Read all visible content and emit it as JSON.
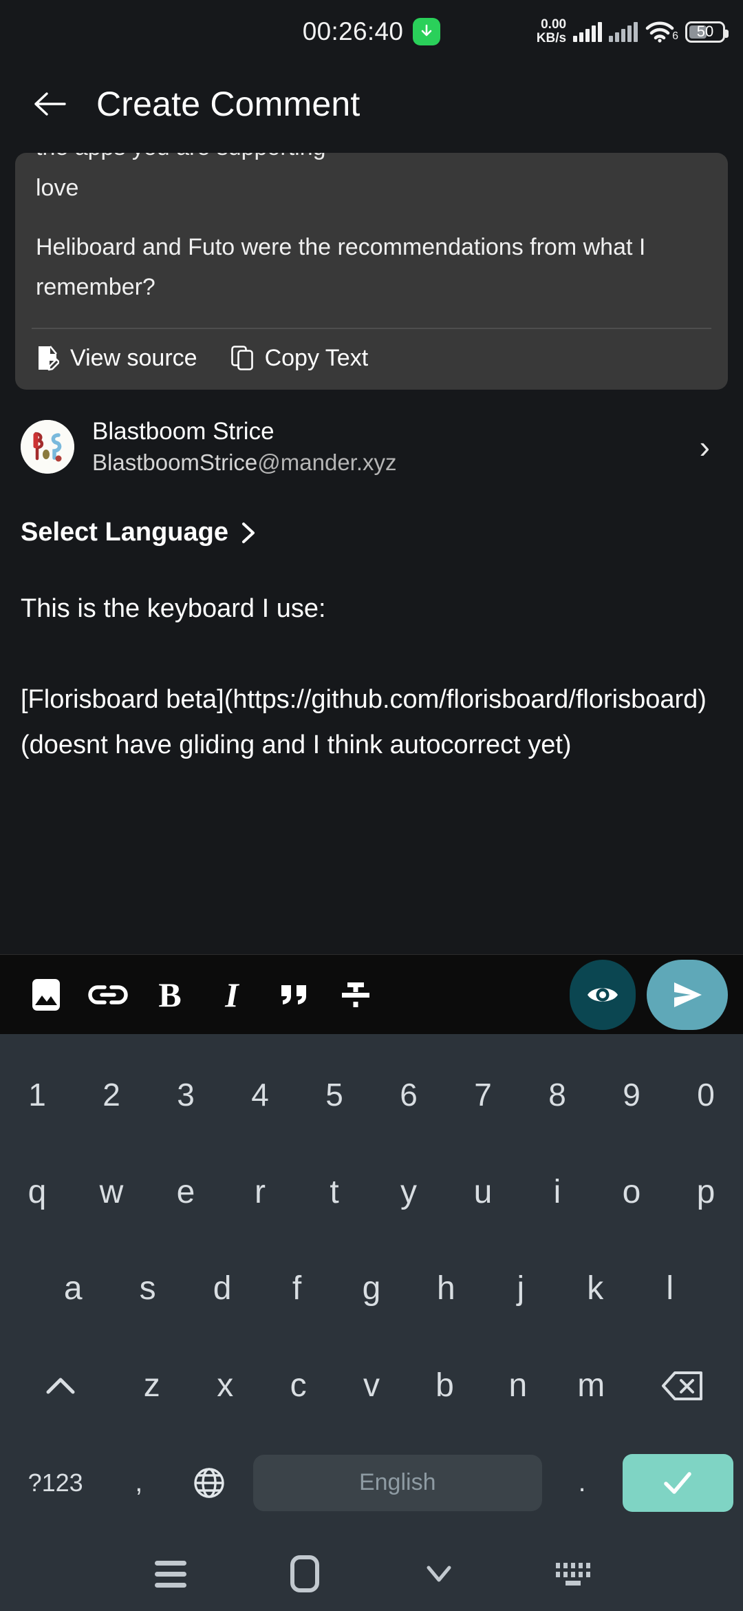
{
  "status_bar": {
    "time": "00:26:40",
    "download_icon": "download-arrow-icon",
    "net_speed_value": "0.00",
    "net_speed_unit": "KB/s",
    "wifi_generation": "6",
    "battery_percent": "50",
    "signal_icon": "cellular-signal-icon",
    "wifi_icon": "wifi-icon",
    "battery_icon": "battery-icon"
  },
  "app_bar": {
    "back_icon": "back-arrow-icon",
    "title": "Create Comment"
  },
  "quoted_comment": {
    "clipped_line": "the apps you are supporting",
    "line_1": "love",
    "paragraph": "Heliboard and Futo were the recommendations from what I remember?",
    "actions": [
      {
        "label": "View source",
        "icon": "file-edit-icon"
      },
      {
        "label": "Copy Text",
        "icon": "copy-icon"
      }
    ]
  },
  "user": {
    "display_name": "Blastboom Strice",
    "handle_name": "BlastboomStrice",
    "handle_domain": "@mander.xyz",
    "avatar_icon": "user-avatar-bs-logo",
    "chevron_icon": "chevron-right-icon"
  },
  "language_selector": {
    "label": "Select Language",
    "chevron_icon": "chevron-right-icon"
  },
  "editor": {
    "body": "This is the keyboard I use:\n\n[Florisboard beta](https://github.com/florisboard/florisboard) (doesnt have gliding and I think autocorrect yet)"
  },
  "format_toolbar": {
    "buttons": [
      {
        "name": "insert-image-button",
        "icon": "image-icon"
      },
      {
        "name": "insert-link-button",
        "icon": "link-icon"
      },
      {
        "name": "bold-button",
        "icon": "bold-icon",
        "glyph": "B"
      },
      {
        "name": "italic-button",
        "icon": "italic-icon",
        "glyph": "I"
      },
      {
        "name": "quote-button",
        "icon": "quote-icon"
      },
      {
        "name": "spoiler-button",
        "icon": "spoiler-icon"
      }
    ],
    "preview_button": {
      "name": "preview-button",
      "icon": "eye-icon",
      "color": "#0b4651"
    },
    "send_button": {
      "name": "send-button",
      "icon": "send-paper-plane-icon",
      "color": "#5fa8b8"
    }
  },
  "keyboard": {
    "row_numbers": [
      "1",
      "2",
      "3",
      "4",
      "5",
      "6",
      "7",
      "8",
      "9",
      "0"
    ],
    "row_top": [
      "q",
      "w",
      "e",
      "r",
      "t",
      "y",
      "u",
      "i",
      "o",
      "p"
    ],
    "row_home": [
      "a",
      "s",
      "d",
      "f",
      "g",
      "h",
      "j",
      "k",
      "l"
    ],
    "row_bottom": [
      "z",
      "x",
      "c",
      "v",
      "b",
      "n",
      "m"
    ],
    "shift_icon": "shift-up-icon",
    "backspace_icon": "backspace-icon",
    "symbols_key": "?123",
    "comma_key": ",",
    "globe_icon": "globe-language-icon",
    "space_label": "English",
    "period_key": ".",
    "enter_icon": "checkmark-enter-icon",
    "background_color": "#2c333a",
    "enter_color": "#7fd4c4"
  },
  "nav_bar": {
    "recents_icon": "recents-menu-icon",
    "home_icon": "home-square-icon",
    "hide_keyboard_icon": "chevron-down-icon",
    "switch_keyboard_icon": "keyboard-switch-icon"
  }
}
